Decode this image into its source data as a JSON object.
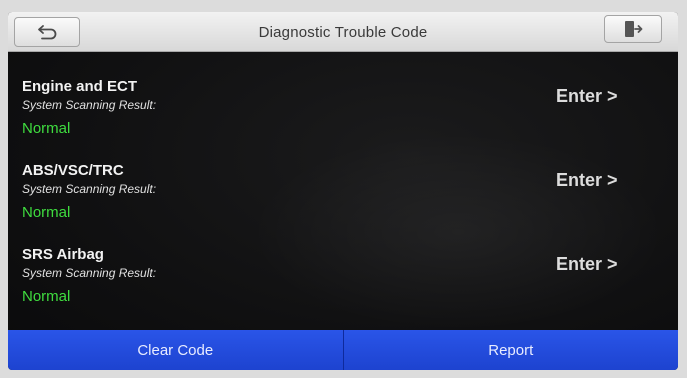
{
  "header": {
    "title": "Diagnostic Trouble Code",
    "back_icon": "back-arrow-icon",
    "exit_icon": "exit-door-icon"
  },
  "systems": [
    {
      "name": "Engine and ECT",
      "sub": "System Scanning Result:",
      "status": "Normal",
      "enter": "Enter >"
    },
    {
      "name": "ABS/VSC/TRC",
      "sub": "System Scanning Result:",
      "status": "Normal",
      "enter": "Enter >"
    },
    {
      "name": "SRS Airbag",
      "sub": "System Scanning Result:",
      "status": "Normal",
      "enter": "Enter >"
    }
  ],
  "footer": {
    "clear_label": "Clear Code",
    "report_label": "Report"
  },
  "colors": {
    "status_normal": "#3fdc3f",
    "button_blue": "#2a55e8",
    "screen_bg": "#101011"
  }
}
